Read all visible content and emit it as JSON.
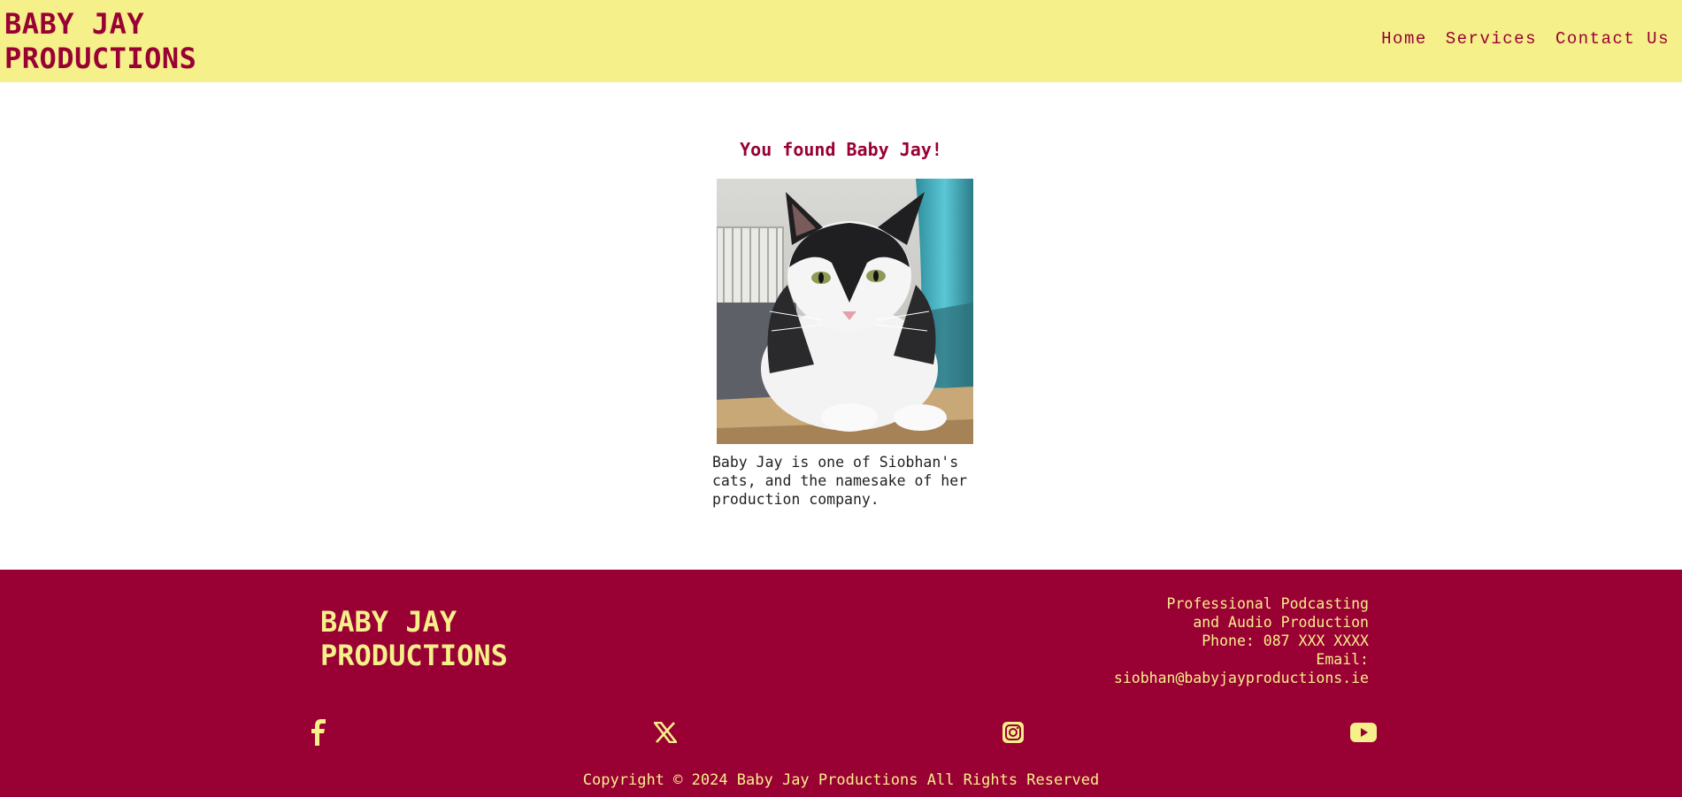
{
  "header": {
    "logo_line1": "BABY JAY",
    "logo_line2": "PRODUCTIONS",
    "nav": [
      "Home",
      "Services",
      "Contact Us"
    ]
  },
  "main": {
    "title": "You found Baby Jay!",
    "image_alt": "Baby Jay the cat",
    "caption_lines": [
      "Baby Jay is one of Siobhan's",
      "cats, and the namesake of her",
      "production company."
    ]
  },
  "footer": {
    "logo_line1": "BABY JAY",
    "logo_line2": "PRODUCTIONS",
    "info_lines": [
      "Professional Podcasting",
      "and Audio Production",
      "Phone: 087 XXX XXXX",
      "Email:",
      "siobhan@babyjayproductions.ie"
    ],
    "social_icons": [
      "facebook-icon",
      "x-icon",
      "instagram-icon",
      "youtube-icon"
    ],
    "copyright": "Copyright © 2024 Baby Jay Productions All Rights Reserved"
  },
  "colors": {
    "brand": "#990033",
    "header_bg": "#f5f08a",
    "footer_text": "#f5f08a"
  }
}
